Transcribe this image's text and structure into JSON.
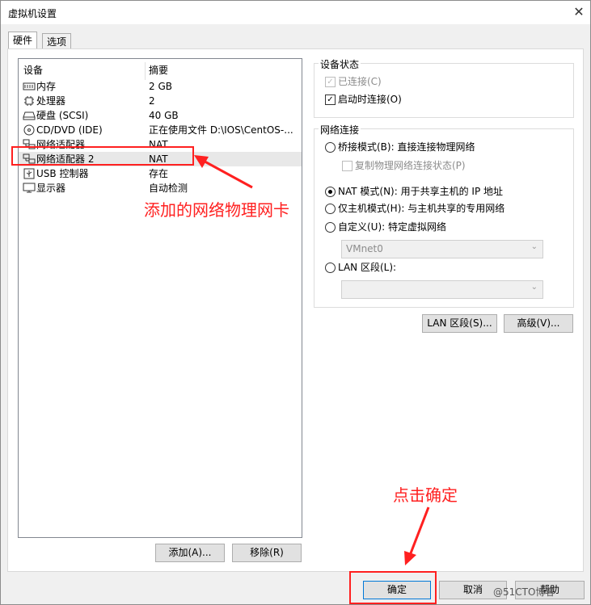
{
  "window": {
    "title": "虚拟机设置",
    "close_glyph": "✕"
  },
  "tabs": [
    {
      "label": "硬件"
    },
    {
      "label": "选项"
    }
  ],
  "device_list": {
    "headers": {
      "device": "设备",
      "summary": "摘要"
    },
    "rows": [
      {
        "name": "内存",
        "summary": "2 GB",
        "icon": "memory-icon"
      },
      {
        "name": "处理器",
        "summary": "2",
        "icon": "cpu-icon"
      },
      {
        "name": "硬盘 (SCSI)",
        "summary": "40 GB",
        "icon": "hard-disk-icon"
      },
      {
        "name": "CD/DVD (IDE)",
        "summary": "正在使用文件 D:\\IOS\\CentOS-...",
        "icon": "cd-dvd-icon"
      },
      {
        "name": "网络适配器",
        "summary": "NAT",
        "icon": "network-adapter-icon"
      },
      {
        "name": "网络适配器 2",
        "summary": "NAT",
        "icon": "network-adapter-icon"
      },
      {
        "name": "USB 控制器",
        "summary": "存在",
        "icon": "usb-icon"
      },
      {
        "name": "显示器",
        "summary": "自动检测",
        "icon": "display-icon"
      }
    ],
    "selected_index": 5
  },
  "device_status": {
    "title": "设备状态",
    "connected_label": "已连接(C)",
    "connected_checked": true,
    "connect_at_power_on_label": "启动时连接(O)",
    "connect_at_power_on_checked": true
  },
  "network_connection": {
    "title": "网络连接",
    "bridged_label": "桥接模式(B): 直接连接物理网络",
    "replicate_label": "复制物理网络连接状态(P)",
    "nat_label": "NAT 模式(N): 用于共享主机的 IP 地址",
    "host_only_label": "仅主机模式(H): 与主机共享的专用网络",
    "custom_label": "自定义(U): 特定虚拟网络",
    "custom_select_value": "VMnet0",
    "lan_segment_label": "LAN 区段(L):",
    "lan_segment_select_value": "",
    "selected": "nat"
  },
  "buttons": {
    "lan_segments": "LAN 区段(S)...",
    "advanced": "高级(V)...",
    "add": "添加(A)...",
    "remove": "移除(R)",
    "ok": "确定",
    "cancel": "取消",
    "help": "帮助"
  },
  "annotations": {
    "added_adapter": "添加的网络物理网卡",
    "click_ok": "点击确定",
    "watermark": "@51CTO博客",
    "color": "#ff2020"
  }
}
